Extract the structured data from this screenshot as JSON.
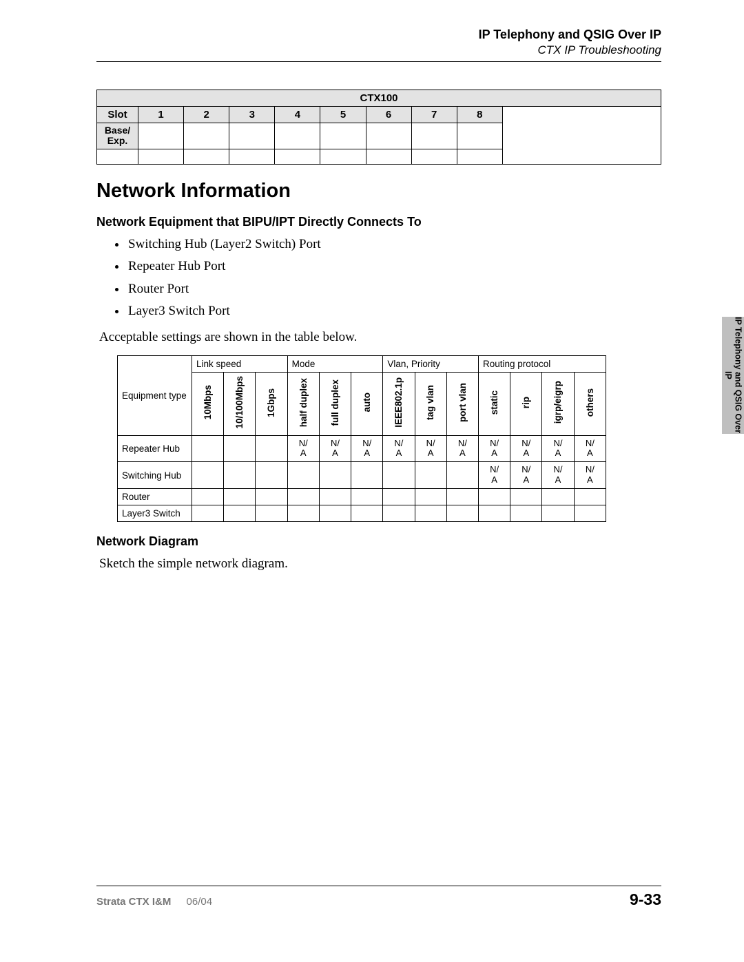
{
  "header": {
    "title": "IP Telephony and QSIG Over IP",
    "subtitle": "CTX IP Troubleshooting"
  },
  "ctx_table": {
    "title": "CTX100",
    "slot_label": "Slot",
    "base_label": "Base/\nExp.",
    "slots": [
      "1",
      "2",
      "3",
      "4",
      "5",
      "6",
      "7",
      "8"
    ]
  },
  "section_title": "Network Information",
  "subsection1": "Network Equipment that BIPU/IPT Directly Connects To",
  "bullets": [
    "Switching Hub (Layer2 Switch) Port",
    "Repeater Hub Port",
    "Router Port",
    "Layer3 Switch Port"
  ],
  "para1": "Acceptable settings are shown in the table below.",
  "eq_table": {
    "eq_label": "Equipment type",
    "groups": {
      "link": "Link speed",
      "mode": "Mode",
      "vlan": "Vlan, Priority",
      "routing": "Routing protocol"
    },
    "cols": {
      "c1": "10Mbps",
      "c2": "10/100Mbps",
      "c3": "1Gbps",
      "c4": "half duplex",
      "c5": "full duplex",
      "c6": "auto",
      "c7": "IEEE802.1p",
      "c8": "tag vlan",
      "c9": "port vlan",
      "c10": "static",
      "c11": "rip",
      "c12": "igrp/eigrp",
      "c13": "others"
    },
    "na": "N/A",
    "rows": [
      {
        "label": "Repeater Hub",
        "cells": [
          "",
          "",
          "",
          "N/A",
          "N/A",
          "N/A",
          "N/A",
          "N/A",
          "N/A",
          "N/A",
          "N/A",
          "N/A",
          "N/A"
        ]
      },
      {
        "label": "Switching Hub",
        "cells": [
          "",
          "",
          "",
          "",
          "",
          "",
          "",
          "",
          "",
          "N/A",
          "N/A",
          "N/A",
          "N/A"
        ]
      },
      {
        "label": "Router",
        "cells": [
          "",
          "",
          "",
          "",
          "",
          "",
          "",
          "",
          "",
          "",
          "",
          "",
          ""
        ]
      },
      {
        "label": "Layer3 Switch",
        "cells": [
          "",
          "",
          "",
          "",
          "",
          "",
          "",
          "",
          "",
          "",
          "",
          "",
          ""
        ]
      }
    ]
  },
  "subsection2": "Network Diagram",
  "para2": "Sketch the simple network diagram.",
  "sidetab": "IP Telephony and QSIG Over IP",
  "footer": {
    "left": "Strata CTX I&M",
    "date": "06/04",
    "page": "9-33"
  }
}
